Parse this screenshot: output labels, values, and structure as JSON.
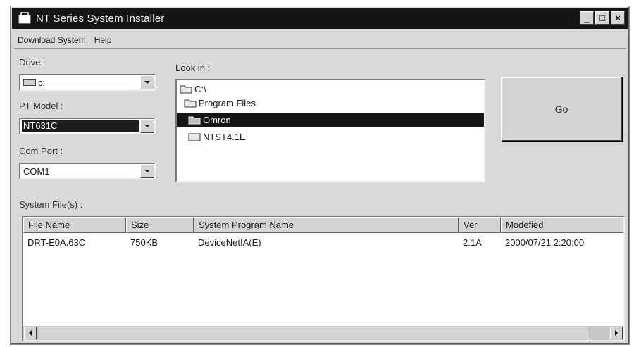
{
  "window": {
    "title": "NT Series System Installer",
    "buttons": {
      "minimize": "_",
      "maximize": "□",
      "close": "×"
    }
  },
  "menu": {
    "items": [
      {
        "label": "Download System",
        "accel": "D"
      },
      {
        "label": "Help",
        "accel": "H"
      }
    ]
  },
  "drive": {
    "label": "Drive :",
    "value": "c:"
  },
  "pt_model": {
    "label": "PT Model :",
    "value": "NT631C"
  },
  "com_port": {
    "label": "Com Port :",
    "value": "COM1"
  },
  "look_in": {
    "label": "Look in :",
    "folders": [
      {
        "name": "C:\\",
        "selected": false
      },
      {
        "name": "Program Files",
        "selected": false
      },
      {
        "name": "Omron",
        "selected": true
      },
      {
        "name": "NTST4.1E",
        "selected": false
      }
    ]
  },
  "go_button": {
    "label": "Go"
  },
  "system_files": {
    "label": "System File(s) :",
    "columns": [
      "File Name",
      "Size",
      "System Program Name",
      "Ver",
      "Modefied"
    ],
    "rows": [
      [
        "DRT-E0A.63C",
        "750KB",
        "DeviceNetIA(E)",
        "2.1A",
        "2000/07/21 2:20:00"
      ]
    ]
  },
  "colors": {
    "titlebar": "#151515",
    "face": "#d9d9d9",
    "selection": "#151515"
  }
}
